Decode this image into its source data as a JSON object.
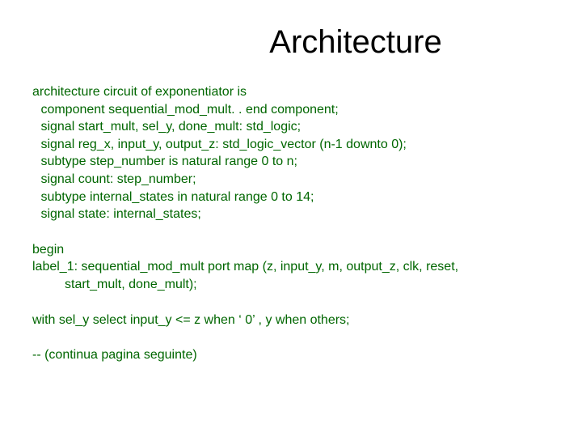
{
  "title": "Architecture",
  "block1": {
    "l0": "architecture circuit of exponentiator is",
    "l1": " component sequential_mod_mult. . end component;",
    "l2": " signal start_mult, sel_y, done_mult: std_logic;",
    "l3": " signal reg_x, input_y, output_z: std_logic_vector (n-1 downto 0);",
    "l4": " subtype step_number is natural range 0 to n;",
    "l5": " signal count: step_number;",
    "l6": " subtype internal_states in natural range 0 to 14;",
    "l7": " signal state: internal_states;"
  },
  "block2": {
    "l0": "begin",
    "l1": "label_1: sequential_mod_mult port map (z, input_y, m, output_z, clk, reset,",
    "l1b": "start_mult, done_mult);"
  },
  "block3": {
    "l0": "with sel_y select input_y <= z when ‘ 0’ , y when others;"
  },
  "block4": {
    "l0": "-- (continua pagina seguinte)"
  }
}
